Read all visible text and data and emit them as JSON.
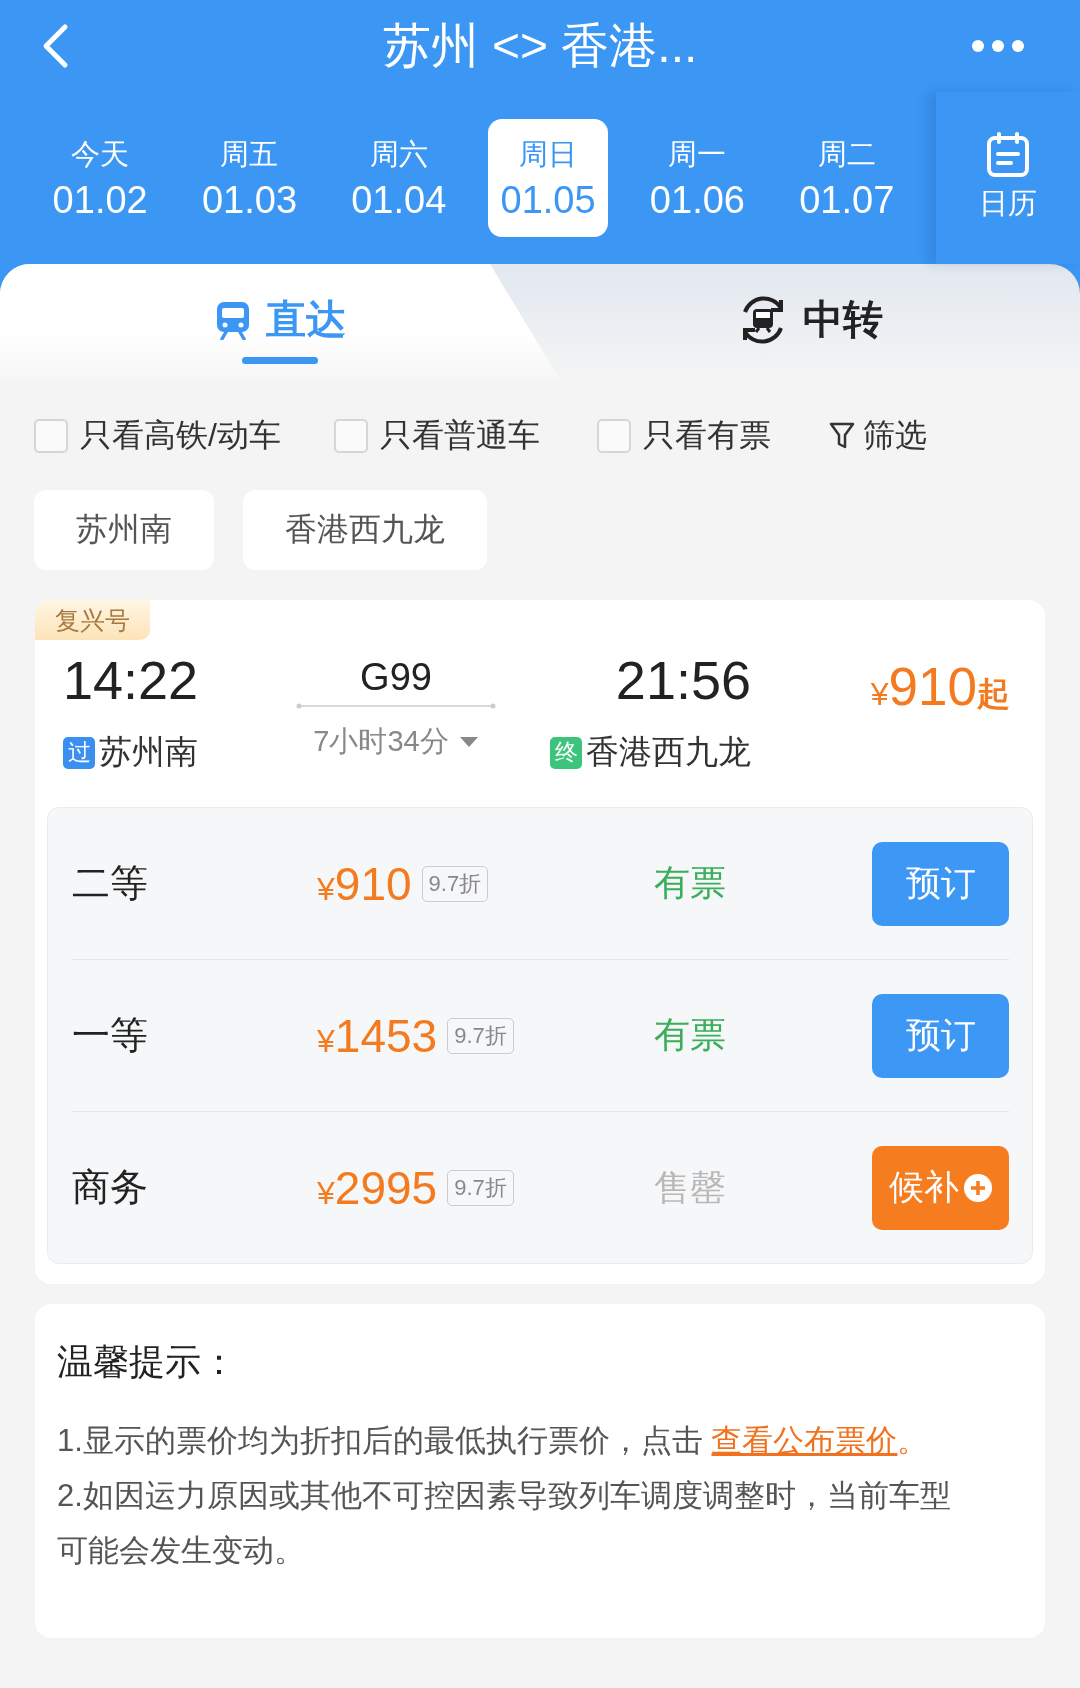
{
  "header": {
    "title": "苏州 <> 香港..."
  },
  "dates": [
    {
      "weekday": "今天",
      "date": "01.02",
      "selected": false
    },
    {
      "weekday": "周五",
      "date": "01.03",
      "selected": false
    },
    {
      "weekday": "周六",
      "date": "01.04",
      "selected": false
    },
    {
      "weekday": "周日",
      "date": "01.05",
      "selected": true
    },
    {
      "weekday": "周一",
      "date": "01.06",
      "selected": false
    },
    {
      "weekday": "周二",
      "date": "01.07",
      "selected": false
    }
  ],
  "calendar": {
    "label": "日历"
  },
  "mode_tabs": [
    {
      "label": "直达",
      "kind": "direct",
      "selected": true
    },
    {
      "label": "中转",
      "kind": "transfer",
      "selected": false
    }
  ],
  "filters": [
    {
      "label": "只看高铁/动车",
      "checked": false
    },
    {
      "label": "只看普通车",
      "checked": false
    },
    {
      "label": "只看有票",
      "checked": false
    }
  ],
  "filter_button": {
    "label": "筛选"
  },
  "stations": [
    "苏州南",
    "香港西九龙"
  ],
  "train": {
    "badge": "复兴号",
    "train_no": "G99",
    "duration": "7小时34分",
    "stops": [
      {
        "time": "14:22",
        "tag": "过",
        "station": "苏州南",
        "color": "#3a8ff0"
      },
      {
        "time": "21:56",
        "tag": "终",
        "station": "香港西九龙",
        "color": "#3cc47c"
      }
    ],
    "price": {
      "symbol": "¥",
      "amount": "910",
      "suffix": "起"
    },
    "seats": [
      {
        "class": "二等",
        "symbol": "¥",
        "price": "910",
        "discount": "9.7折",
        "availability": "有票",
        "available": true,
        "action": "预订",
        "kind": "book"
      },
      {
        "class": "一等",
        "symbol": "¥",
        "price": "1453",
        "discount": "9.7折",
        "availability": "有票",
        "available": true,
        "action": "预订",
        "kind": "book"
      },
      {
        "class": "商务",
        "symbol": "¥",
        "price": "2995",
        "discount": "9.7折",
        "availability": "售罄",
        "available": false,
        "action": "候补",
        "kind": "waitlist"
      }
    ]
  },
  "tips": {
    "title": "温馨提示：",
    "items": [
      {
        "text": "1.显示的票价均为折扣后的最低执行票价，点击 ",
        "link": "查看公布票价",
        "end": "。"
      },
      {
        "text": "2.如因运力原因或其他不可控因素导致列车调度调整时，当前车型可能会发生变动。"
      }
    ]
  }
}
